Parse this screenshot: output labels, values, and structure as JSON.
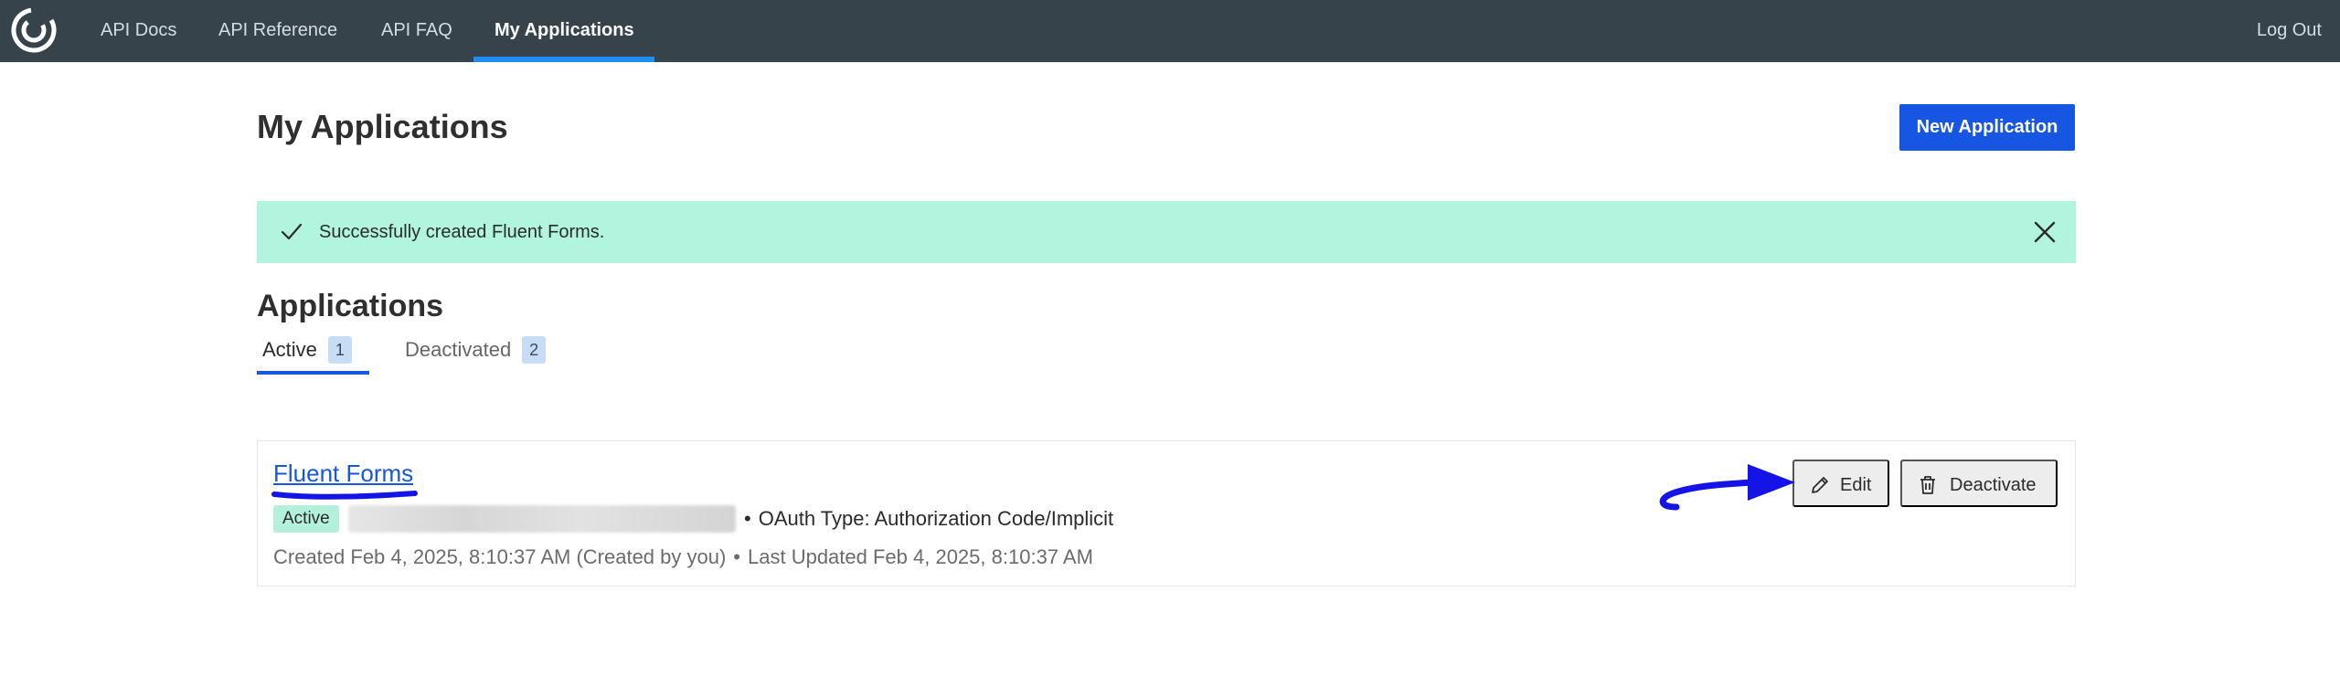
{
  "nav": {
    "logo_icon": "circular-c-logo-icon",
    "items": [
      {
        "label": "API Docs"
      },
      {
        "label": "API Reference"
      },
      {
        "label": "API FAQ"
      },
      {
        "label": "My Applications"
      }
    ],
    "active_index": 3,
    "logout_label": "Log Out"
  },
  "header": {
    "title": "My Applications",
    "new_app_label": "New Application"
  },
  "alert": {
    "message": "Successfully created Fluent Forms.",
    "check_icon": "checkmark-icon",
    "close_icon": "close-icon"
  },
  "applications": {
    "title": "Applications",
    "tabs": [
      {
        "label": "Active",
        "count": "1"
      },
      {
        "label": "Deactivated",
        "count": "2"
      }
    ],
    "list": [
      {
        "name": "Fluent Forms",
        "status": "Active",
        "oauth": "OAuth Type: Authorization Code/Implicit",
        "created": "Created Feb 4, 2025, 8:10:37 AM (Created by you)",
        "updated": "Last Updated Feb 4, 2025, 8:10:37 AM",
        "separator": "•",
        "edit_label": "Edit",
        "edit_icon": "pencil-icon",
        "deactivate_label": "Deactivate",
        "deactivate_icon": "trash-icon"
      }
    ]
  },
  "colors": {
    "nav_bg": "#36434b",
    "nav_active_underline": "#1f8ef1",
    "primary": "#1755e3",
    "alert_bg": "#b1f5de",
    "annotation": "#1414e6"
  }
}
